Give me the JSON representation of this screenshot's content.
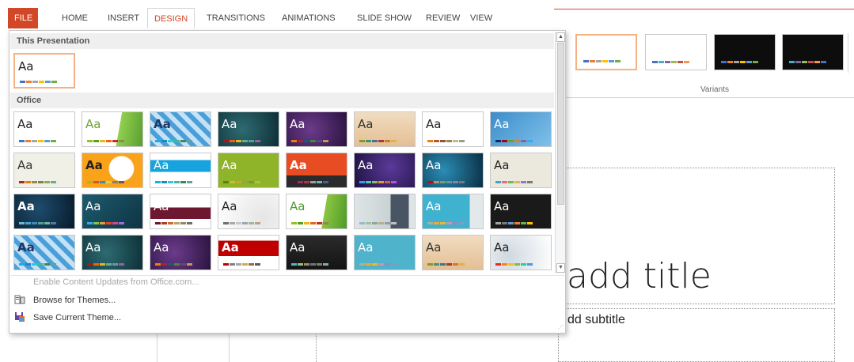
{
  "ribbon": {
    "tabs": [
      "FILE",
      "HOME",
      "INSERT",
      "DESIGN",
      "TRANSITIONS",
      "ANIMATIONS",
      "SLIDE SHOW",
      "REVIEW",
      "VIEW"
    ],
    "active_tab": "DESIGN",
    "variants_label": "Variants"
  },
  "gallery": {
    "section_this": "This Presentation",
    "section_office": "Office",
    "thumb_text": "Aa",
    "scroll_up": "▲",
    "scroll_down": "▼",
    "menu": {
      "enable_updates": "Enable Content Updates from Office.com...",
      "browse": "Browse for Themes...",
      "save": "Save Current Theme..."
    }
  },
  "slide": {
    "title": "add title",
    "subtitle": "dd subtitle"
  },
  "colors": {
    "accent": "#d24726",
    "selection": "#f4b183"
  }
}
